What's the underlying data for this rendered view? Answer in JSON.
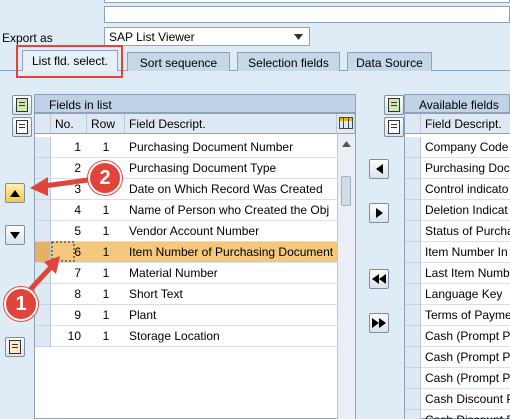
{
  "export": {
    "label": "Export as",
    "value": "SAP List Viewer"
  },
  "tabs": [
    {
      "label": "List fld. select.",
      "active": true
    },
    {
      "label": "Sort sequence"
    },
    {
      "label": "Selection fields"
    },
    {
      "label": "Data Source"
    }
  ],
  "left_panel": {
    "title": "Fields in list",
    "columns": [
      "No.",
      "Row",
      "Field Descript."
    ],
    "rows": [
      {
        "no": "1",
        "row": "1",
        "desc": "Purchasing Document Number"
      },
      {
        "no": "2",
        "row": "1",
        "desc": "Purchasing Document Type"
      },
      {
        "no": "3",
        "row": "1",
        "desc": "Date on Which Record Was Created"
      },
      {
        "no": "4",
        "row": "1",
        "desc": "Name of Person who Created the Obj"
      },
      {
        "no": "5",
        "row": "1",
        "desc": "Vendor Account Number"
      },
      {
        "no": "6",
        "row": "1",
        "desc": "Item Number of Purchasing Document",
        "selected": true
      },
      {
        "no": "7",
        "row": "1",
        "desc": "Material Number"
      },
      {
        "no": "8",
        "row": "1",
        "desc": "Short Text"
      },
      {
        "no": "9",
        "row": "1",
        "desc": "Plant"
      },
      {
        "no": "10",
        "row": "1",
        "desc": "Storage Location"
      }
    ]
  },
  "right_panel": {
    "title": "Available fields",
    "columns": [
      "Field Descript."
    ],
    "rows": [
      "Company Code",
      "Purchasing Docu",
      "Control indicato",
      "Deletion Indicat",
      "Status of Purcha",
      "Item Number In",
      "Last Item Numb",
      "Language Key",
      "Terms of Payme",
      "Cash (Prompt Pa",
      "Cash (Prompt Pa",
      "Cash (Prompt Pa",
      "Cash Discount P",
      "Cash Discount P"
    ]
  },
  "callouts": [
    "1",
    "2"
  ],
  "colors": {
    "accent": "#e0443a",
    "selected_row": "#f3c77c",
    "header": "#bfd2e6"
  }
}
